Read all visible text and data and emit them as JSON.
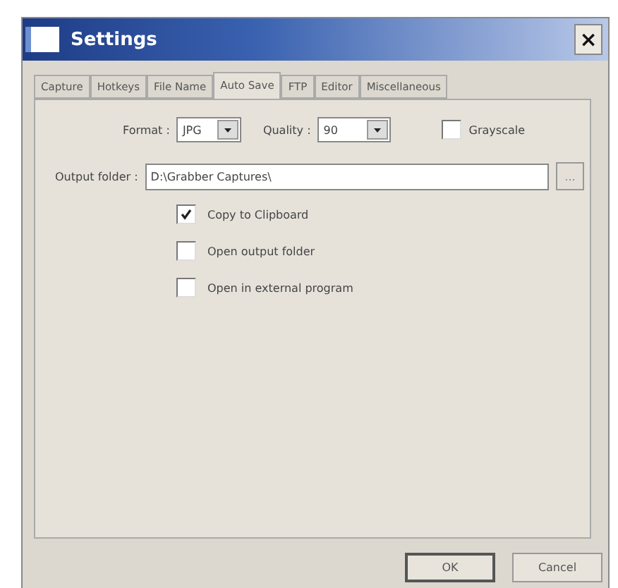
{
  "window": {
    "title": "Settings",
    "close": "×"
  },
  "tabs": [
    {
      "label": "Capture",
      "selected": false
    },
    {
      "label": "Hotkeys",
      "selected": false
    },
    {
      "label": "File Name",
      "selected": false
    },
    {
      "label": "Auto Save",
      "selected": true
    },
    {
      "label": "FTP",
      "selected": false
    },
    {
      "label": "Editor",
      "selected": false
    },
    {
      "label": "Miscellaneous",
      "selected": false
    }
  ],
  "format": {
    "label": "Format :",
    "value": "JPG"
  },
  "quality": {
    "label": "Quality :",
    "value": "90"
  },
  "grayscale": {
    "label": "Grayscale",
    "checked": false
  },
  "output_folder": {
    "label": "Output folder :",
    "value": "D:\\Grabber Captures\\",
    "browse": "..."
  },
  "options": [
    {
      "label": "Copy to Clipboard",
      "checked": true
    },
    {
      "label": "Open output folder",
      "checked": false
    },
    {
      "label": "Open in external program",
      "checked": false
    }
  ],
  "buttons": [
    {
      "label": "OK",
      "default": true
    },
    {
      "label": "Cancel",
      "default": false
    }
  ]
}
